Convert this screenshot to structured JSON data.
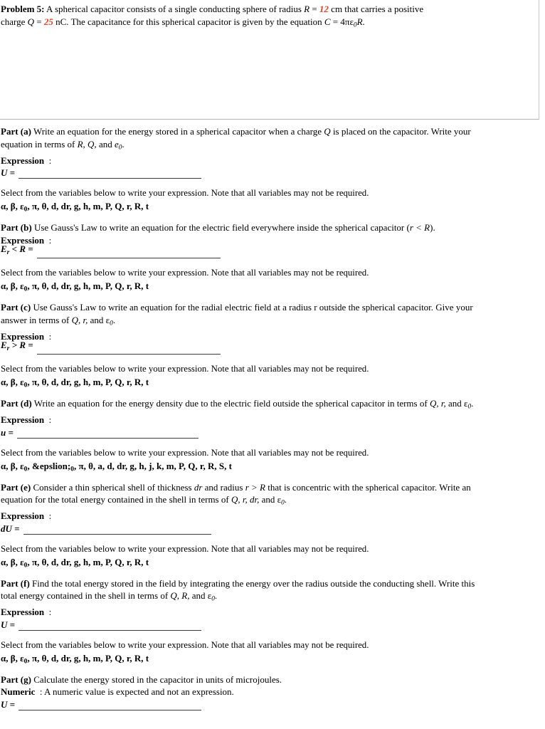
{
  "header": {
    "problem_label": "Problem 5:",
    "line1_part1": " A spherical capacitor consists of a single conducting sphere of radius ",
    "radius_symbol": "R",
    "eq1": " = ",
    "radius_value": "12",
    "line1_part2": " cm that carries a positive",
    "line2_part1": "charge ",
    "charge_symbol": "Q",
    "eq2": " = ",
    "charge_value": "25",
    "line2_part2": " nC. The capacitance for this spherical capacitor is given by the equation ",
    "cap_symbol": "C",
    "eq3": " = 4",
    "cap_formula_pi": "πε",
    "cap_formula_sub": "0",
    "cap_formula_R": "R",
    "period": "."
  },
  "variable_lists": {
    "standard": "α, β, ε",
    "standard_sub": "0",
    "standard_rest": ", π, θ, d, dr, g, h, m, P, Q, r, R, t",
    "extended_pre": "α, β, ε",
    "extended_sub1": "0",
    "extended_mid": ", &epslion;",
    "extended_sub2": "0",
    "extended_rest": ", π, θ, a, d, dr, g, h, j, k, m, P, Q, r, R, S, t"
  },
  "select_note": "Select from the variables below to write your expression. Note that all variables may not be required.",
  "parts": [
    {
      "label": "Part (a)",
      "prompt_line1": " Write an equation for the energy stored in a spherical capacitor when a charge ",
      "prompt_italic1": "Q",
      "prompt_line2": " is placed on the capacitor. Write your",
      "prompt_line3": "equation in terms of ",
      "prompt_italic2": "R, Q,",
      "prompt_line4": " and ",
      "prompt_italic3": "e",
      "prompt_sub": "0",
      "prompt_end": ".",
      "kind": "Expression",
      "kind_sep": "  :",
      "answer_var": "U",
      "answer_eq": " =",
      "blank_width": 257,
      "var_list": "standard"
    },
    {
      "label": "Part (b)",
      "prompt_line1": " Use Gauss's Law to write an equation for the electric field everywhere inside the spherical capacitor (",
      "prompt_italic1": "r < R",
      "prompt_line2": ").",
      "kind": "Expression",
      "kind_sep": "  :",
      "answer_var": "E",
      "answer_sub": "r",
      "answer_cond": " < R",
      "answer_eq": " =",
      "blank_width": 258,
      "var_list": "standard"
    },
    {
      "label": "Part (c)",
      "prompt_line1": " Use Gauss's Law to write an equation for the radial electric field at a radius r outside the spherical capacitor. Give your",
      "prompt_line2": "answer in terms of ",
      "prompt_italic2": "Q, r,",
      "prompt_line3": " and ε",
      "prompt_sub": "0",
      "prompt_end": ".",
      "kind": "Expression",
      "kind_sep": "  :",
      "answer_var": "E",
      "answer_sub": "r",
      "answer_cond": " > R",
      "answer_eq": " =",
      "blank_width": 258,
      "var_list": "standard"
    },
    {
      "label": "Part (d)",
      "prompt_line1": " Write an equation for the energy density due to the electric field outside the spherical capacitor in terms of ",
      "prompt_italic1": "Q, r,",
      "prompt_line2": " and ε",
      "prompt_sub": "0",
      "prompt_end": ".",
      "kind": "Expression",
      "kind_sep": "  :",
      "answer_var": "u",
      "answer_eq": " =",
      "blank_width": 255,
      "var_list": "extended"
    },
    {
      "label": "Part (e)",
      "prompt_line1": " Consider a thin spherical shell of thickness ",
      "prompt_italic1": "dr",
      "prompt_line2": " and radius ",
      "prompt_italic2": "r > R",
      "prompt_line3": " that is concentric with the spherical capacitor. Write an",
      "prompt_line4": "equation for the total energy contained in the shell in terms of ",
      "prompt_italic3": "Q, r, dr,",
      "prompt_line5": " and ε",
      "prompt_sub": "0",
      "prompt_end": ".",
      "kind": "Expression",
      "kind_sep": "  :",
      "answer_var": "dU",
      "answer_eq": " =",
      "blank_width": 264,
      "var_list": "standard"
    },
    {
      "label": "Part (f)",
      "prompt_line1": " Find the total energy stored in the field by integrating the energy over the radius outside the conducting shell. Write this",
      "prompt_line2": "total energy contained in the shell in terms of ",
      "prompt_italic2": "Q, R,",
      "prompt_line3": " and ε",
      "prompt_sub": "0",
      "prompt_end": ".",
      "kind": "Expression",
      "kind_sep": "  :",
      "answer_var": "U",
      "answer_eq": " =",
      "blank_width": 257,
      "var_list": "standard"
    },
    {
      "label": "Part (g)",
      "prompt_line1": " Calculate the energy stored in the capacitor in units of microjoules.",
      "kind": "Numeric",
      "kind_sep": "  : ",
      "kind_note": "A numeric value is expected and not an expression.",
      "answer_var": "U",
      "answer_eq": " =",
      "blank_width": 257,
      "var_list": null
    }
  ]
}
